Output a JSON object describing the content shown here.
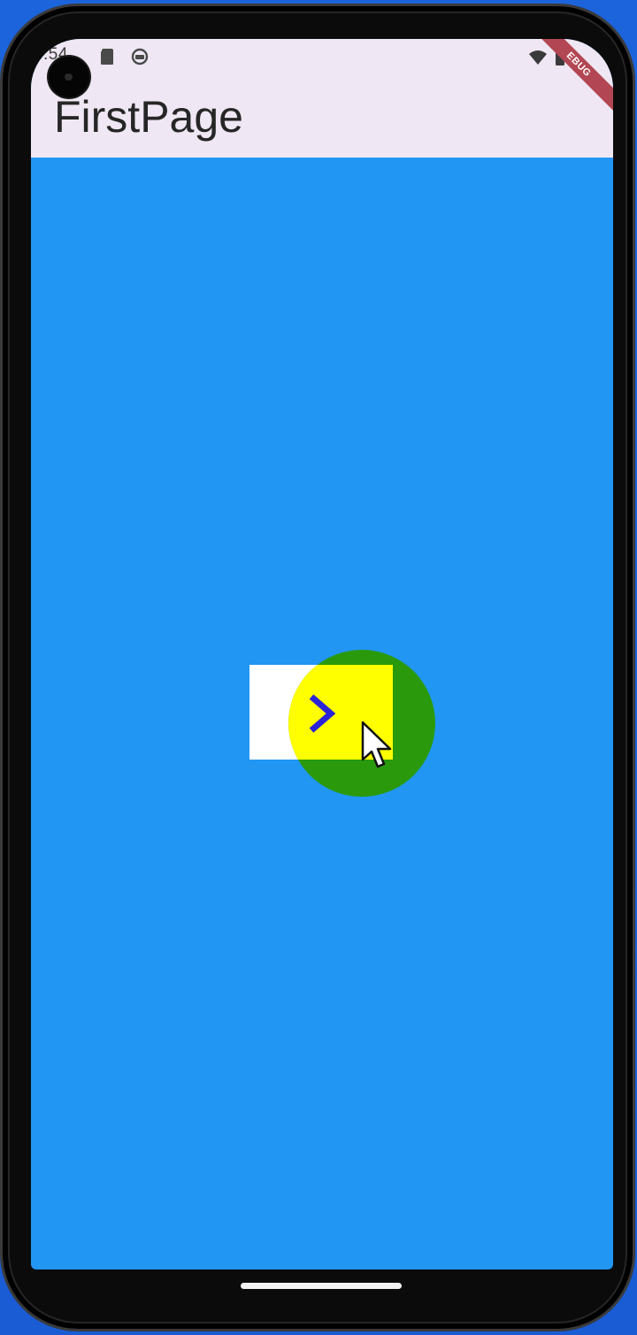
{
  "status_bar": {
    "time": ":54",
    "icons": [
      "sd-card-icon",
      "vpn-icon",
      "wifi-icon",
      "battery-icon"
    ]
  },
  "app_bar": {
    "title": "FirstPage"
  },
  "debug_banner": {
    "label": "EBUG"
  },
  "content": {
    "primary_color": "#2196f3",
    "button_icon": "chevron-right-icon",
    "button_icon_color": "#2b23d6",
    "tap_indicator_color": "#2a9a0c",
    "tap_highlight_color": "#ffff00"
  },
  "system_nav": {
    "home_indicator": "home-indicator"
  }
}
